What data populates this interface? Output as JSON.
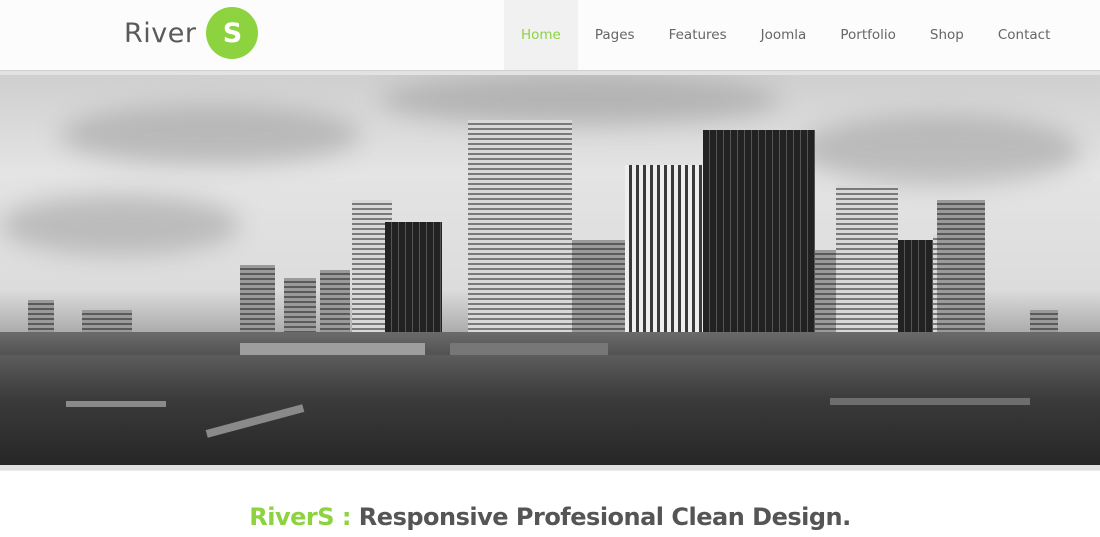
{
  "header": {
    "logo": {
      "text": "River",
      "badge": "S"
    },
    "nav": [
      {
        "label": "Home",
        "active": true
      },
      {
        "label": "Pages",
        "active": false
      },
      {
        "label": "Features",
        "active": false
      },
      {
        "label": "Joomla",
        "active": false
      },
      {
        "label": "Portfolio",
        "active": false
      },
      {
        "label": "Shop",
        "active": false
      },
      {
        "label": "Contact",
        "active": false
      }
    ]
  },
  "hero": {
    "image": "black-and-white-city-skyline-photo"
  },
  "tagline": {
    "brand": "RiverS :",
    "text": " Responsive Profesional Clean Design."
  },
  "colors": {
    "accent": "#8cd33f",
    "text": "#555555",
    "nav_active_bg": "#f1f1f1"
  }
}
